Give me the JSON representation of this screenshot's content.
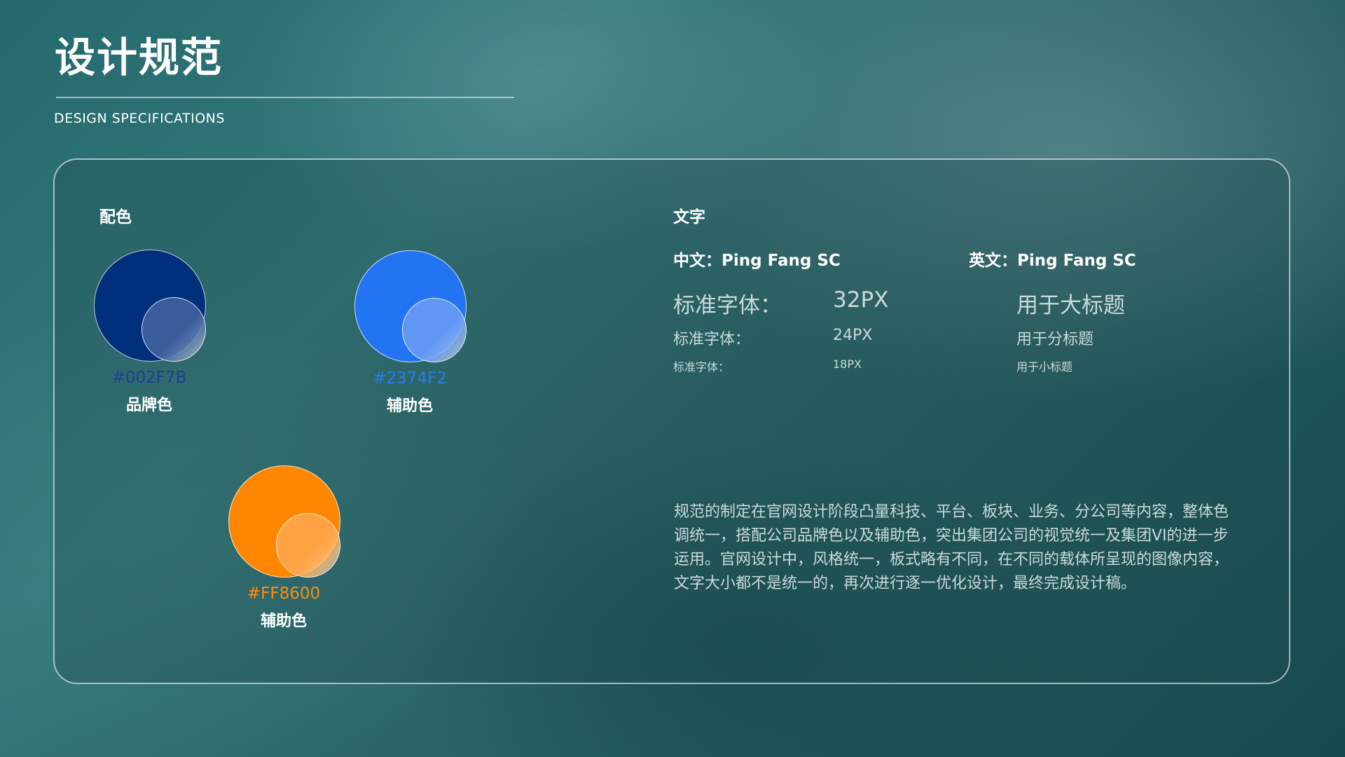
{
  "header": {
    "title": "设计规范",
    "subtitle": "DESIGN SPECIFICATIONS"
  },
  "colors_section": {
    "heading": "配色",
    "swatches": [
      {
        "hex": "#002F7B",
        "label": "品牌色",
        "color": "#002F7B",
        "hex_text_color": "#1d3f94",
        "overlay_color": "#3a5c9a"
      },
      {
        "hex": "#2374F2",
        "label": "辅助色",
        "color": "#2374F2",
        "hex_text_color": "#2b7af0",
        "overlay_color": "#5f97f2"
      },
      {
        "hex": "#FF8600",
        "label": "辅助色",
        "color": "#FF8600",
        "hex_text_color": "#ff8c10",
        "overlay_color": "#ffa244"
      }
    ]
  },
  "typography_section": {
    "heading": "文字",
    "fonts": {
      "chinese": "中文：Ping Fang SC",
      "english": "英文：Ping Fang SC"
    },
    "rows": [
      {
        "label": "标准字体：",
        "size": "32PX",
        "usage": "用于大标题"
      },
      {
        "label": "标准字体：",
        "size": "24PX",
        "usage": "用于分标题"
      },
      {
        "label": "标准字体：",
        "size": "18PX",
        "usage": "用于小标题"
      }
    ],
    "description": "规范的制定在官网设计阶段凸量科技、平台、板块、业务、分公司等内容，整体色调统一，搭配公司品牌色以及辅助色，突出集团公司的视觉统一及集团VI的进一步运用。官网设计中，风格统一，板式略有不同，在不同的载体所呈现的图像内容，文字大小都不是统一的，再次进行逐一优化设计，最终完成设计稿。"
  }
}
